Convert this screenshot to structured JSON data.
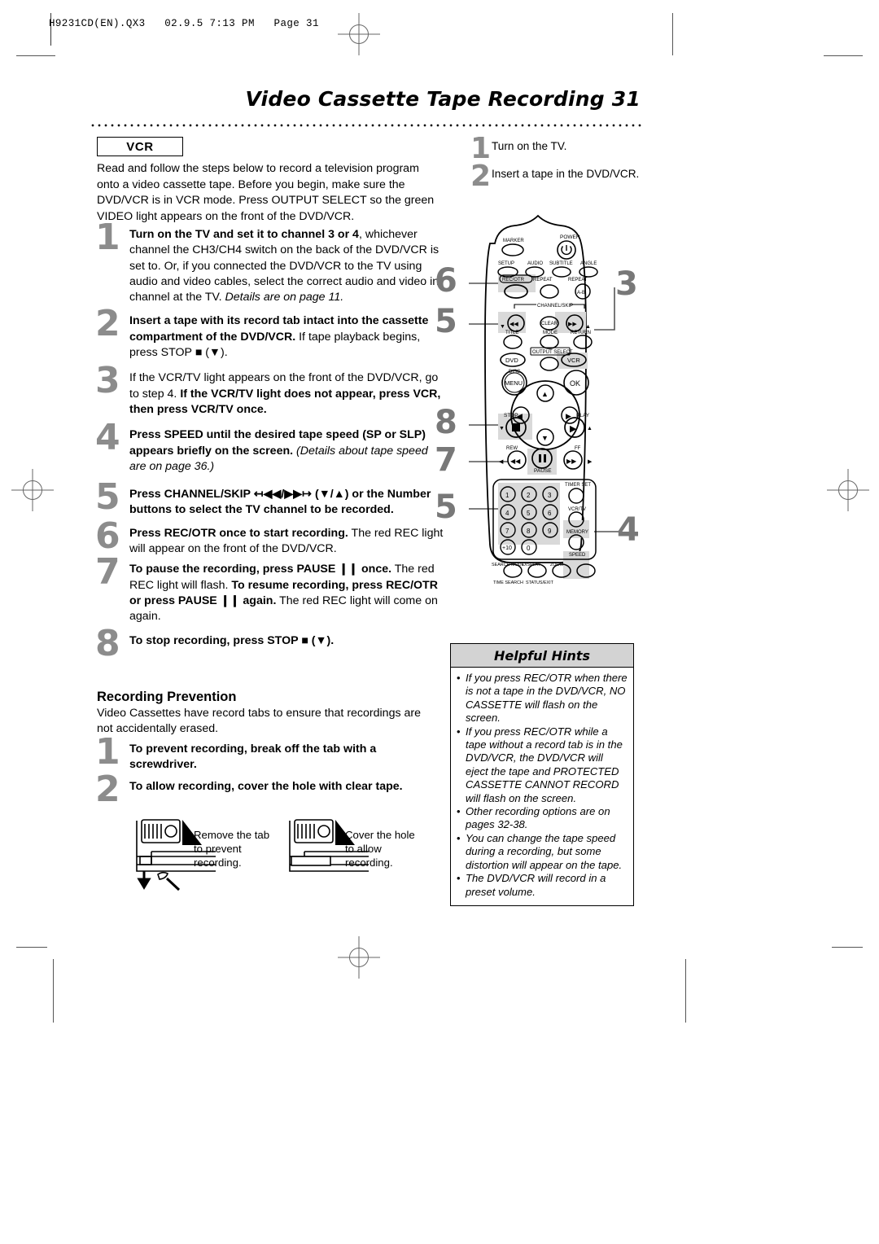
{
  "print_header": {
    "text": "H9231CD(EN).QX3   02.9.5 7:13 PM   Page 31"
  },
  "page_title": "Video Cassette Tape Recording  31",
  "section_badge": "VCR",
  "intro": "Read and follow the steps below to record a television program onto a video cassette tape. Before you begin, make sure the DVD/VCR is in VCR mode. Press OUTPUT SELECT so the green VIDEO light appears on the front of the DVD/VCR.",
  "steps": [
    {
      "number": "1",
      "html": "<b>Turn on the TV and set it to channel 3 or 4</b>, whichever channel the CH3/CH4 switch on the back of the DVD/VCR is set to. Or, if you connected the DVD/VCR to the TV using audio and video cables, select the correct audio and video in channel at the TV. <i>Details are on page 11.</i>"
    },
    {
      "number": "2",
      "html": "<b>Insert a tape with its record tab intact into the cassette compartment of the DVD/VCR.</b> If tape playback begins, press STOP &#9632; (&#9660;)."
    },
    {
      "number": "3",
      "html": "If the VCR/TV light appears on the front of the DVD/VCR, go to step 4. <b>If the VCR/TV light does not appear, press VCR, then press VCR/TV once.</b>"
    },
    {
      "number": "4",
      "html": "<b>Press SPEED until the desired tape speed (SP or SLP) appears briefly on the screen.</b> <i>(Details about tape speed are on page 36.)</i>"
    },
    {
      "number": "5",
      "html": "<b>Press CHANNEL/SKIP &#8612;&#9664;&#9664;/&#9654;&#9654;&#8614; (&#9660;/&#9650;) or the Number buttons to select the TV channel to be recorded.</b>"
    },
    {
      "number": "6",
      "html": "<b>Press REC/OTR once to start recording.</b> The red REC light will appear on the front of the DVD/VCR."
    },
    {
      "number": "7",
      "html": "<b>To pause the recording, press PAUSE &#10073;&#10073; once.</b> The red REC light will flash. <b>To resume recording, press REC/OTR or press PAUSE &#10073;&#10073; again.</b> The red REC light will come on again."
    },
    {
      "number": "8",
      "html": "<b>To stop recording, press STOP &#9632; (&#9660;).</b>"
    }
  ],
  "prevention": {
    "heading": "Recording Prevention",
    "paragraph": "Video Cassettes have record tabs to ensure that recordings are not accidentally erased.",
    "steps": [
      {
        "number": "1",
        "html": "<b>To prevent recording, break off the tab with a screwdriver.</b>"
      },
      {
        "number": "2",
        "html": "<b>To allow recording, cover the hole with clear tape.</b>"
      }
    ],
    "figures": [
      {
        "caption": "Remove the tab to prevent recording."
      },
      {
        "caption": "Cover the hole to allow recording."
      }
    ]
  },
  "right_steps": [
    {
      "number": "1",
      "text": "Turn on the TV."
    },
    {
      "number": "2",
      "text": "Insert a tape in the DVD/VCR."
    }
  ],
  "remote": {
    "callouts": [
      "6",
      "5",
      "3",
      "8",
      "7",
      "5",
      "4"
    ],
    "labels": {
      "power": "POWER",
      "marker": "MARKER",
      "setup": "SETUP",
      "audio": "AUDIO",
      "subtitle": "SUBTITLE",
      "angle": "ANGLE",
      "rec_otr": "REC/OTR",
      "repeat": "REPEAT",
      "repeat_ab": "REPEAT",
      "repeat_ab_btn": "A-B",
      "channel_skip": "CHANNEL/SKIP",
      "clear": "CLEAR",
      "title": "TITLE",
      "mode": "MODE",
      "return": "RETURN",
      "output_select": "OUTPUT SELECT",
      "dvd": "DVD",
      "vcr": "VCR",
      "disc": "DISC",
      "menu": "MENU",
      "ok": "OK",
      "stop": "STOP",
      "play": "PLAY",
      "rew": "REW",
      "pause": "PAUSE",
      "ff": "FF",
      "timer_set": "TIMER SET",
      "vcr_tv": "VCR/TV",
      "memory": "MEMORY",
      "speed": "SPEED",
      "slow": "SLOW",
      "search_mode": "SEARCH MODE",
      "display": "DISPLAY",
      "zoom": "ZOOM",
      "time_search": "TIME SEARCH",
      "status_exit": "STATUS/EXIT",
      "plus10": "+10"
    },
    "number_keys": [
      "1",
      "2",
      "3",
      "4",
      "5",
      "6",
      "7",
      "8",
      "9",
      "+10",
      "0"
    ]
  },
  "hints": {
    "title": "Helpful Hints",
    "items": [
      "If you press REC/OTR when there is not a tape in the DVD/VCR, NO CASSETTE will flash on the screen.",
      "If you press REC/OTR while a tape without a record tab is in the DVD/VCR, the DVD/VCR will eject the tape and PROTECTED CASSETTE CANNOT RECORD will flash on the screen.",
      "Other recording options are on pages 32-38.",
      "You can change the tape speed during a recording, but some distortion will appear on the tape.",
      "The DVD/VCR will record in a preset volume."
    ]
  },
  "colors": {
    "callout_gray": "#787878",
    "step_number_gray": "#8c8c8c",
    "hints_header_bg": "#d3d3d3"
  }
}
